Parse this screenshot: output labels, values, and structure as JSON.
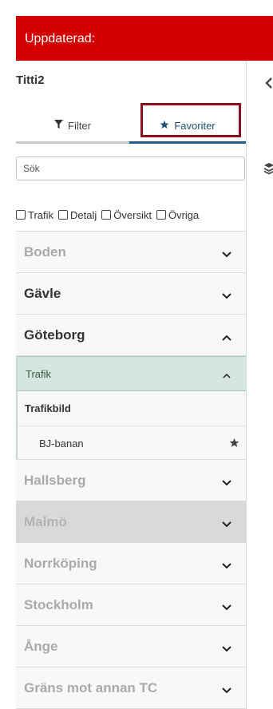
{
  "header": {
    "title": "Uppdaterad:"
  },
  "user": {
    "name": "Titti2"
  },
  "tabs": [
    {
      "label": "Filter",
      "icon": "filter-icon"
    },
    {
      "label": "Favoriter",
      "icon": "star-icon"
    }
  ],
  "search": {
    "placeholder": "Sök"
  },
  "filters": [
    "Trafik",
    "Detalj",
    "Översikt",
    "Övriga"
  ],
  "locations": [
    {
      "label": "Boden",
      "style": "dim",
      "expanded": false
    },
    {
      "label": "Gävle",
      "style": "dark",
      "expanded": false
    },
    {
      "label": "Göteborg",
      "style": "dark",
      "expanded": true
    },
    {
      "label": "Hallsberg",
      "style": "dim",
      "expanded": false
    },
    {
      "label": "Malmö",
      "style": "gray",
      "expanded": false
    },
    {
      "label": "Norrköping",
      "style": "dim",
      "expanded": false
    },
    {
      "label": "Stockholm",
      "style": "dim",
      "expanded": false
    },
    {
      "label": "Ånge",
      "style": "dim",
      "expanded": false
    },
    {
      "label": "Gräns mot annan TC",
      "style": "dim",
      "expanded": false
    }
  ],
  "goteborg": {
    "category": "Trafik",
    "section": "Trafikbild",
    "item": "BJ-banan"
  },
  "colors": {
    "header": "#d40000",
    "accent": "#1f5c8f",
    "highlight": "#8c0f1e",
    "subheader": "#d5e6df"
  }
}
